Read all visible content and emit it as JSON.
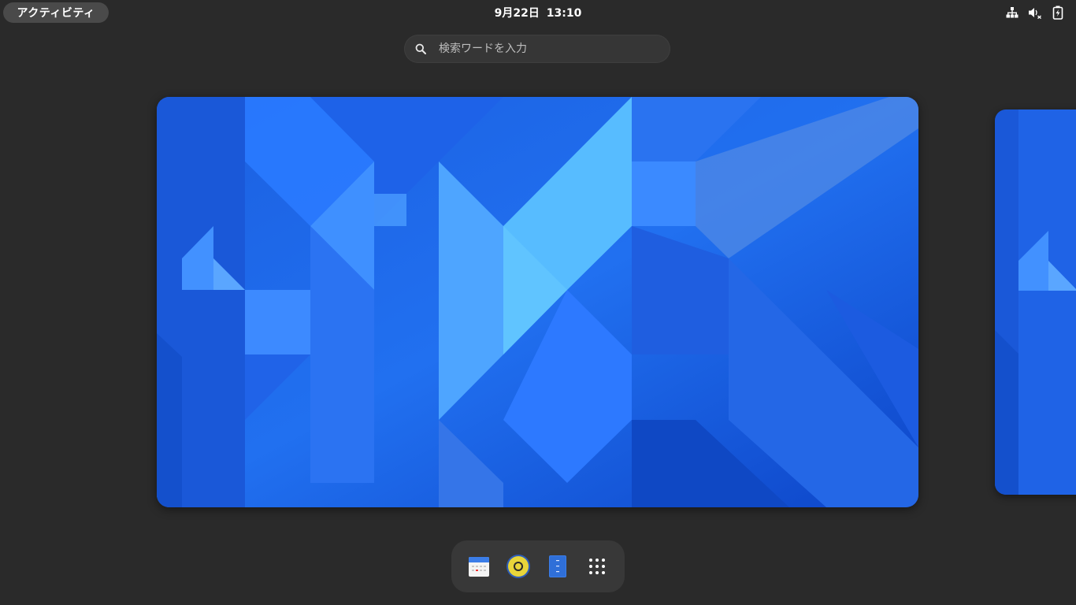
{
  "topbar": {
    "activities_label": "アクティビティ",
    "clock": "9月22日  13:10",
    "tray_icons": [
      "network-wired-icon",
      "audio-muted-icon",
      "battery-charging-icon"
    ]
  },
  "search": {
    "placeholder": "検索ワードを入力"
  },
  "workspaces": {
    "current": {
      "wallpaper": "blue-geometric"
    },
    "next": {
      "wallpaper": "blue-geometric"
    }
  },
  "dash": {
    "items": [
      {
        "name": "calendar-app-icon"
      },
      {
        "name": "rhythmbox-app-icon"
      },
      {
        "name": "files-app-icon"
      },
      {
        "name": "show-apps-grid-icon"
      }
    ]
  },
  "colors": {
    "panel_bg": "#2a2a2a",
    "wallpaper_blue": "#1f66e8",
    "wallpaper_light": "#4fb8ff"
  }
}
